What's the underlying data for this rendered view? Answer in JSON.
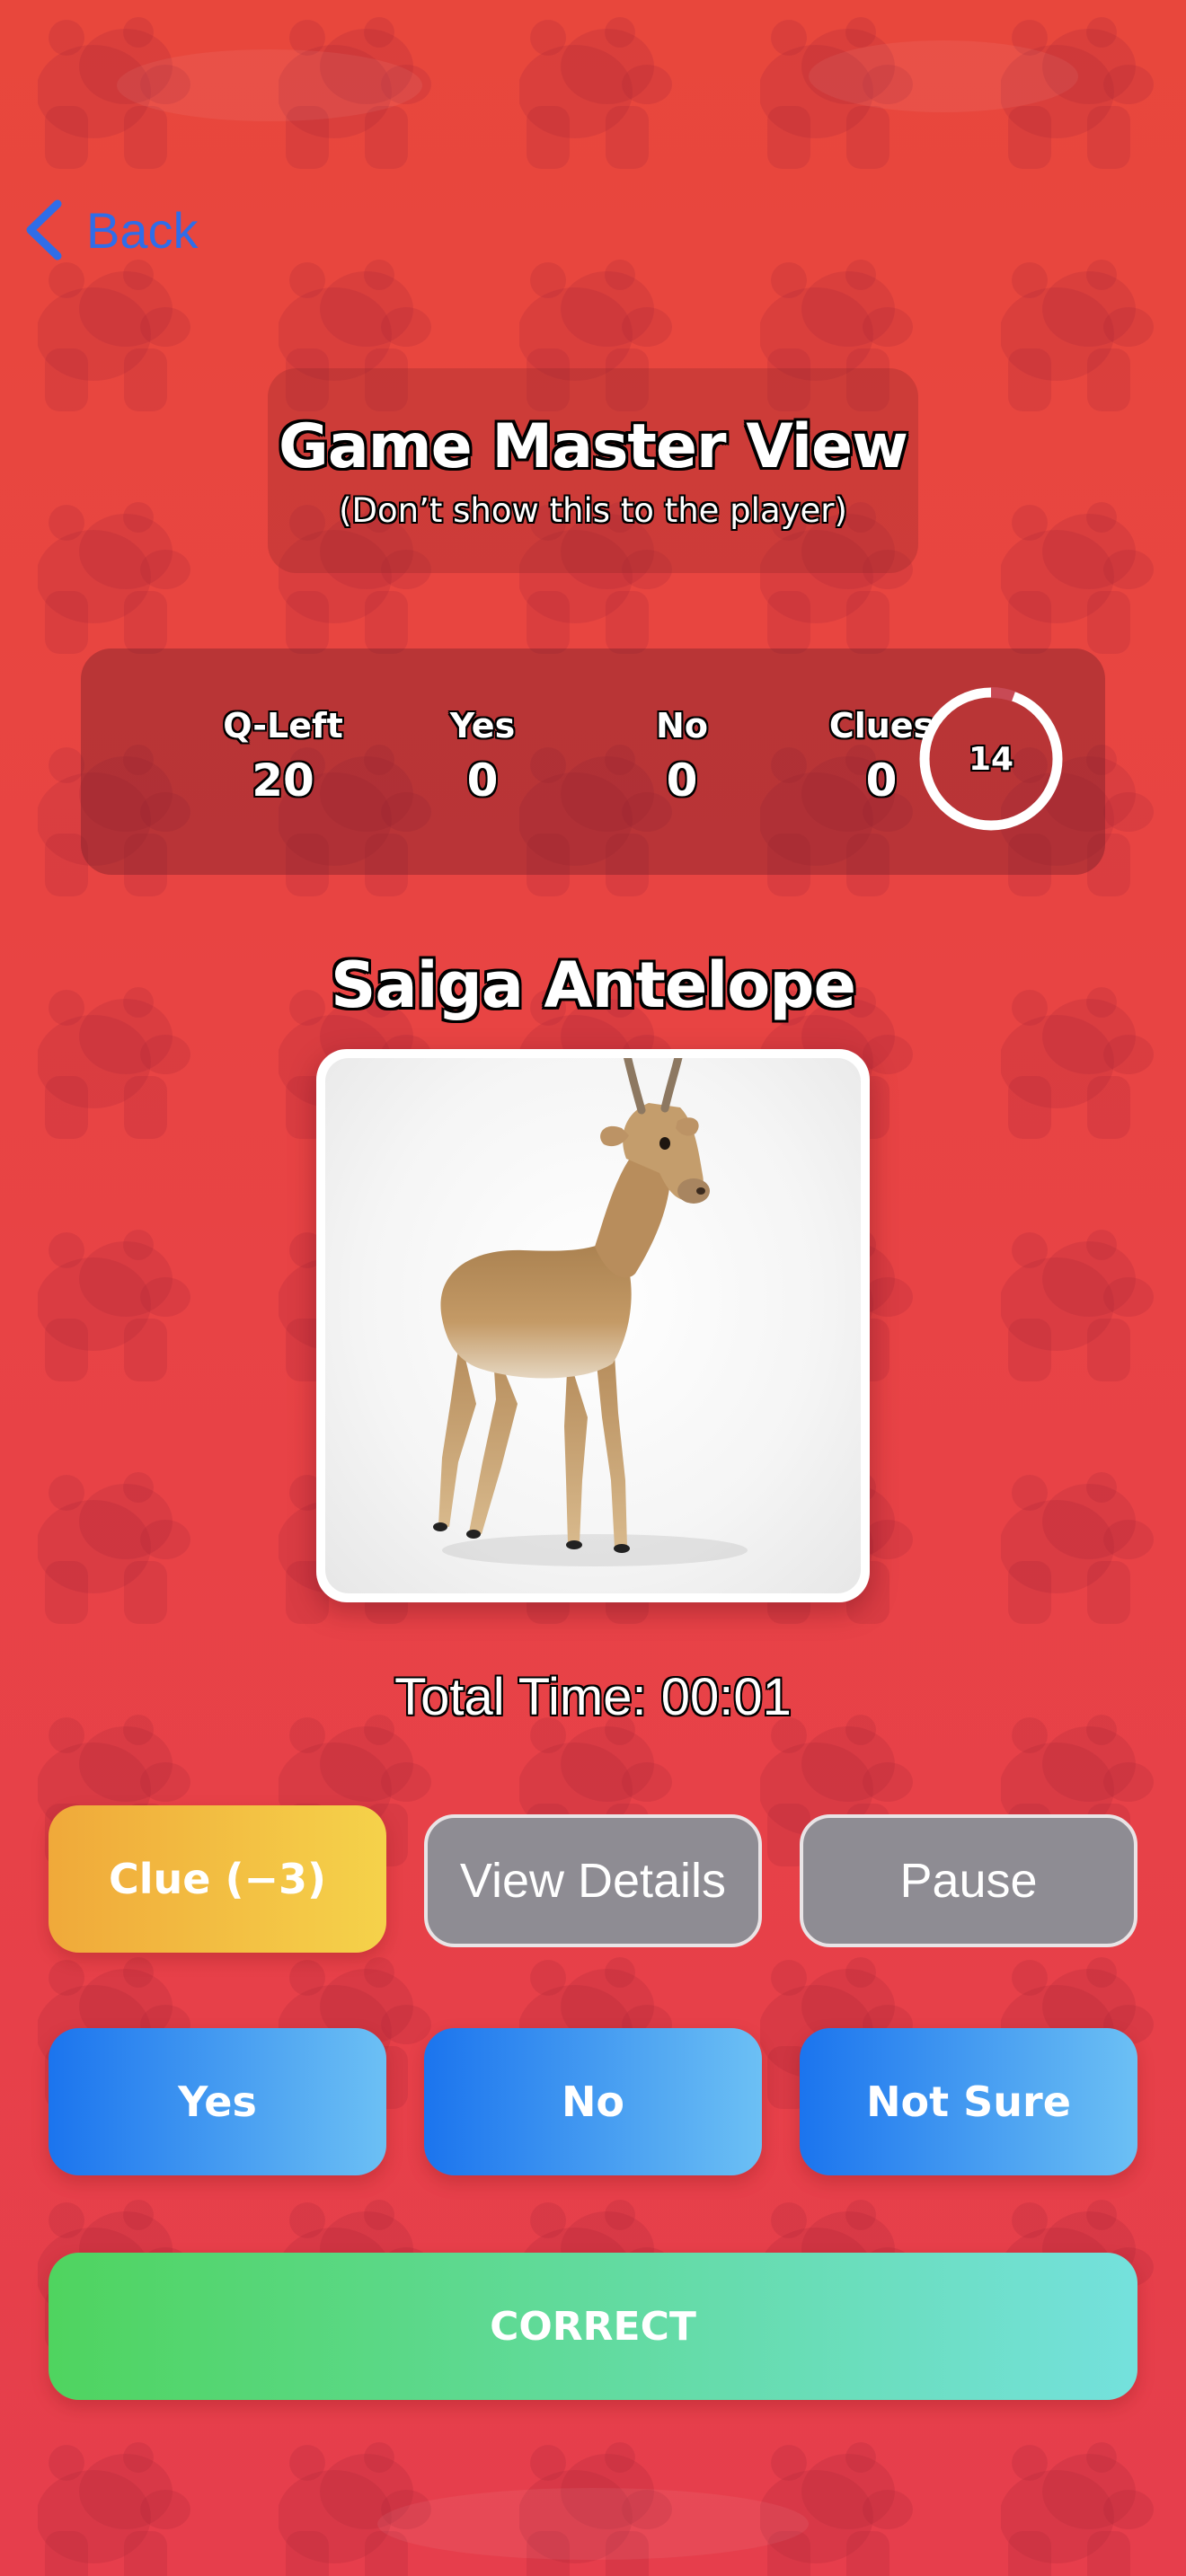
{
  "nav": {
    "back_label": "Back"
  },
  "header": {
    "title": "Game Master View",
    "subtitle": "(Don’t show this to the player)"
  },
  "stats": {
    "q_left_label": "Q-Left",
    "q_left_value": "20",
    "yes_label": "Yes",
    "yes_value": "0",
    "no_label": "No",
    "no_value": "0",
    "clues_label": "Clues",
    "clues_value": "0",
    "timer_value": "14"
  },
  "animal": {
    "name": "Saiga Antelope",
    "image_icon": "saiga-antelope-photo"
  },
  "total_time": "Total Time: 00:01",
  "buttons": {
    "clue": "Clue (−3)",
    "view_details": "View Details",
    "pause": "Pause",
    "yes": "Yes",
    "no": "No",
    "not_sure": "Not Sure",
    "correct": "CORRECT"
  },
  "colors": {
    "background": "#e8473c",
    "back_link": "#2f6de8",
    "clue_gradient": [
      "#f0a93a",
      "#f5d24a"
    ],
    "answer_gradient": [
      "#1b74ee",
      "#6cc0f4"
    ],
    "correct_gradient": [
      "#4fd45f",
      "#74e1dd"
    ],
    "secondary_button": "#8e8c93"
  }
}
